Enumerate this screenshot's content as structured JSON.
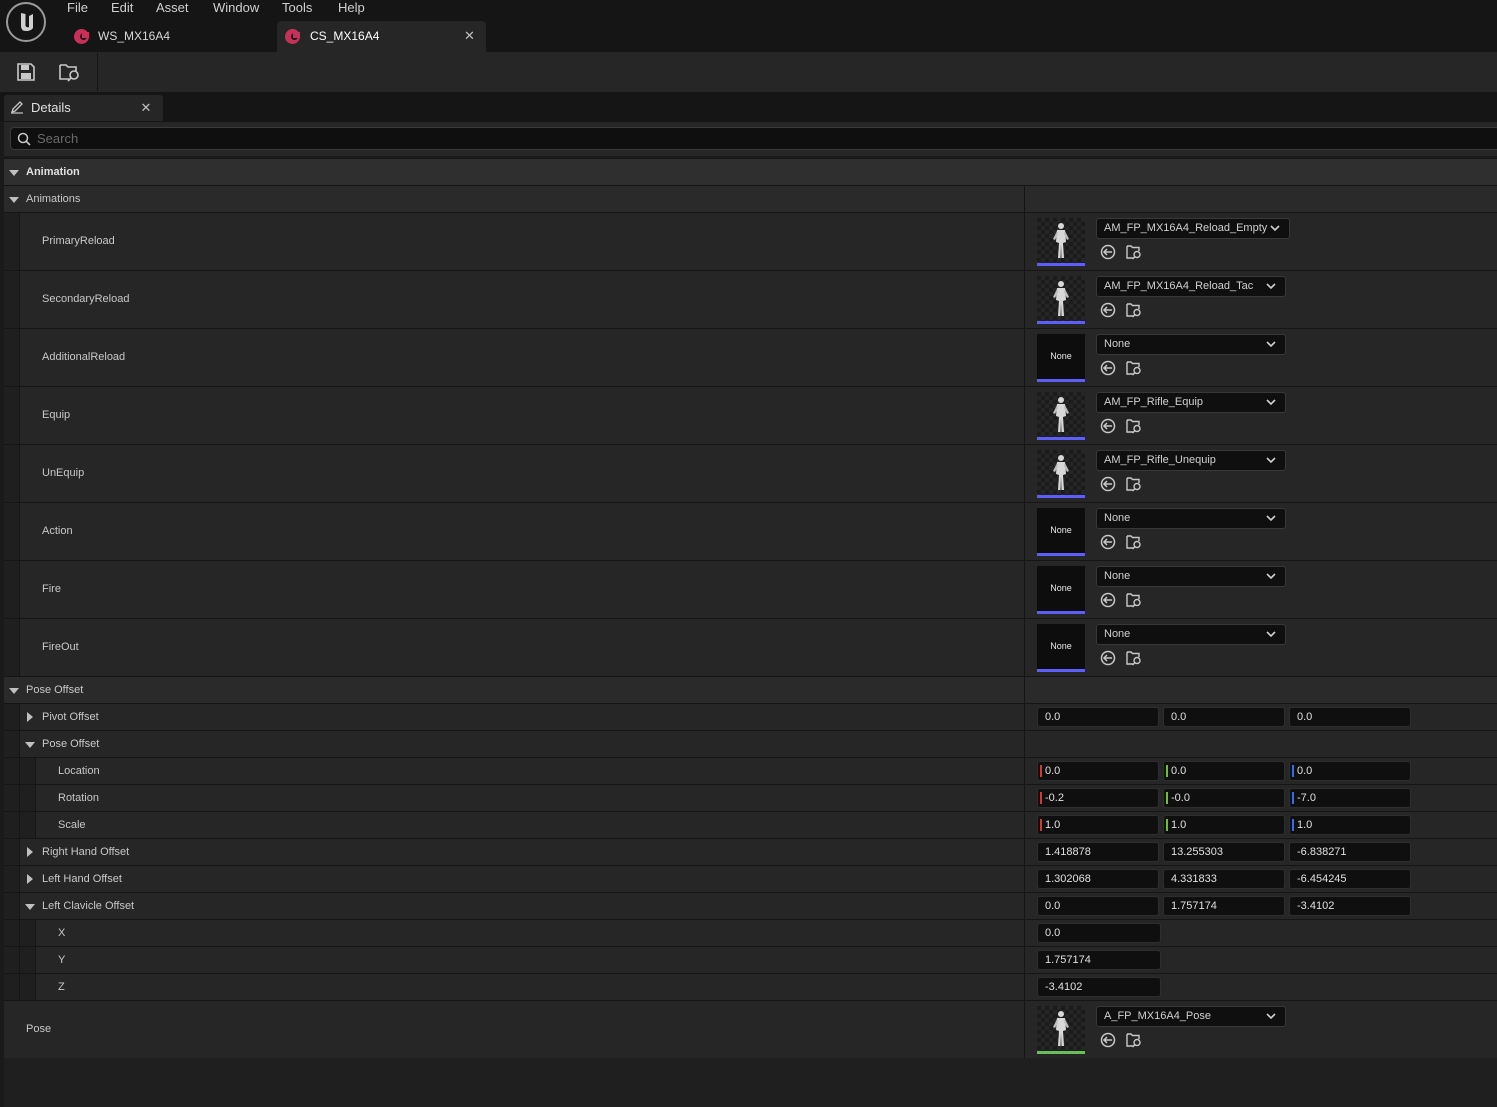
{
  "menu": [
    "File",
    "Edit",
    "Asset",
    "Window",
    "Tools",
    "Help"
  ],
  "tabs": [
    {
      "label": "WS_MX16A4",
      "active": false
    },
    {
      "label": "CS_MX16A4",
      "active": true
    }
  ],
  "toolbar": {
    "save_icon": "save-icon",
    "browse_icon": "browse-to-asset-icon"
  },
  "details": {
    "tab_label": "Details",
    "search_placeholder": "Search"
  },
  "categories": {
    "animation": "Animation",
    "animations": "Animations",
    "pose_offset_group": "Pose Offset"
  },
  "animations": [
    {
      "label": "PrimaryReload",
      "value": "AM_FP_MX16A4_Reload_Empty",
      "has_thumb": true
    },
    {
      "label": "SecondaryReload",
      "value": "AM_FP_MX16A4_Reload_Tac",
      "has_thumb": true
    },
    {
      "label": "AdditionalReload",
      "value": "None",
      "has_thumb": false
    },
    {
      "label": "Equip",
      "value": "AM_FP_Rifle_Equip",
      "has_thumb": true
    },
    {
      "label": "UnEquip",
      "value": "AM_FP_Rifle_Unequip",
      "has_thumb": true
    },
    {
      "label": "Action",
      "value": "None",
      "has_thumb": false
    },
    {
      "label": "Fire",
      "value": "None",
      "has_thumb": false
    },
    {
      "label": "FireOut",
      "value": "None",
      "has_thumb": false
    }
  ],
  "thumb_none_text": "None",
  "pose_offset": {
    "pivot_offset": {
      "label": "Pivot Offset",
      "values": [
        "0.0",
        "0.0",
        "0.0"
      ]
    },
    "pose_offset": {
      "label": "Pose Offset"
    },
    "location": {
      "label": "Location",
      "values": [
        "0.0",
        "0.0",
        "0.0"
      ]
    },
    "rotation": {
      "label": "Rotation",
      "values": [
        "-0.2",
        "-0.0",
        "-7.0"
      ]
    },
    "scale": {
      "label": "Scale",
      "values": [
        "1.0",
        "1.0",
        "1.0"
      ]
    },
    "right_hand_offset": {
      "label": "Right Hand Offset",
      "values": [
        "1.418878",
        "13.255303",
        "-6.838271"
      ]
    },
    "left_hand_offset": {
      "label": "Left Hand Offset",
      "values": [
        "1.302068",
        "4.331833",
        "-6.454245"
      ]
    },
    "left_clavicle_offset": {
      "label": "Left Clavicle Offset",
      "values": [
        "0.0",
        "1.757174",
        "-3.4102"
      ]
    },
    "x": {
      "label": "X",
      "value": "0.0"
    },
    "y": {
      "label": "Y",
      "value": "1.757174"
    },
    "z": {
      "label": "Z",
      "value": "-3.4102"
    }
  },
  "pose": {
    "label": "Pose",
    "value": "A_FP_MX16A4_Pose"
  },
  "colors": {
    "axis_x": "#d9372b",
    "axis_y": "#6cbf2f",
    "axis_z": "#2f6cf0",
    "anim_montage": "#5e5eff",
    "anim_sequence": "#6abf5a",
    "tab_icon": "#c8305a"
  }
}
